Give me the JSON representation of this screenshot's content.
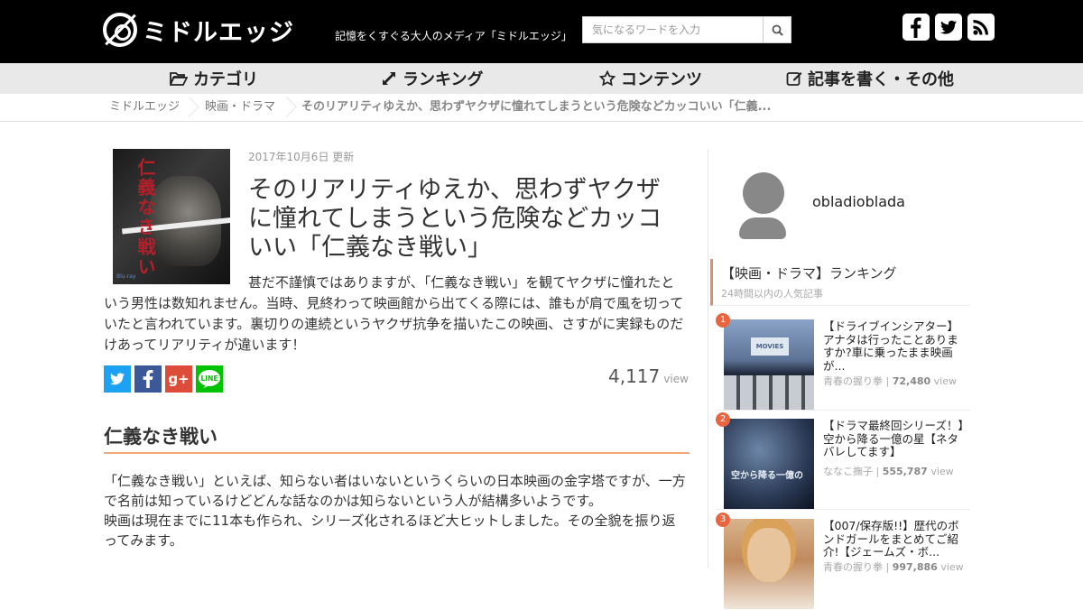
{
  "header": {
    "logo_text": "ミドルエッジ",
    "tagline": "記憶をくすぐる大人のメディア「ミドルエッジ」",
    "search_placeholder": "気になるワードを入力",
    "social_icons": [
      "facebook-icon",
      "twitter-icon",
      "rss-icon"
    ]
  },
  "nav": {
    "items": [
      {
        "label": "カテゴリ",
        "icon": "folder-open-icon"
      },
      {
        "label": "ランキング",
        "icon": "expand-arrows-icon"
      },
      {
        "label": "コンテンツ",
        "icon": "star-icon"
      },
      {
        "label": "記事を書く・その他",
        "icon": "edit-icon"
      }
    ]
  },
  "breadcrumb": [
    "ミドルエッジ",
    "映画・ドラマ",
    "そのリアリティゆえか、思わずヤクザに憧れてしまうという危険などカッコいい「仁義..."
  ],
  "article": {
    "hero_text": "仁義なき戦い",
    "date": "2017年10月6日 更新",
    "title": "そのリアリティゆえか、思わずヤクザに憧れてしまうという危険などカッコいい「仁義なき戦い」",
    "lead": "甚だ不謹慎ではありますが、「仁義なき戦い」を観てヤクザに憧れたという男性は数知れません。当時、見終わって映画館から出てくる際には、誰もが肩で風を切っていたと言われています。裏切りの連続というヤクザ抗争を描いたこの映画、さすがに実録ものだけあってリアリティが違います！",
    "views_count": "4,117",
    "views_label": "view",
    "share_buttons": [
      "twitter-share-icon",
      "facebook-share-icon",
      "google-plus-share-icon",
      "line-share-icon"
    ],
    "section_heading": "仁義なき戦い",
    "body_p1": "「仁義なき戦い」といえば、知らない者はいないというくらいの日本映画の金字塔ですが、一方で名前は知っているけどどんな話なのかは知らないという人が結構多いようです。",
    "body_p2": "映画は現在までに11本も作られ、シリーズ化されるほど大ヒットしました。その全貌を振り返ってみます。"
  },
  "sidebar": {
    "author": "obladioblada",
    "ranking_title": "【映画・ドラマ】ランキング",
    "ranking_subtitle": "24時間以内の人気記事",
    "items": [
      {
        "rank": "1",
        "title": "【ドライブインシアター】アナタは行ったことありますか?車に乗ったまま映画が...",
        "author": "青春の握り拳",
        "views": "72,480",
        "unit": "view",
        "thumb_text": "MOVIES"
      },
      {
        "rank": "2",
        "title": "【ドラマ最終回シリーズ！】空から降る一億の星【ネタバレしてます】",
        "author": "ななこ撫子",
        "views": "555,787",
        "unit": "view",
        "thumb_text": "空から降る一億の"
      },
      {
        "rank": "3",
        "title": "【007/保存版!!】歴代のボンドガールをまとめてご紹介!【ジェームズ・ボ...",
        "author": "青春の握り拳",
        "views": "997,886",
        "unit": "view"
      }
    ]
  },
  "colors": {
    "header_bg": "#000000",
    "nav_bg": "#e9e9e9",
    "accent": "#e8653f",
    "twitter": "#1da1f2",
    "facebook": "#3b5998",
    "google": "#dd4b39",
    "line": "#00c300"
  }
}
